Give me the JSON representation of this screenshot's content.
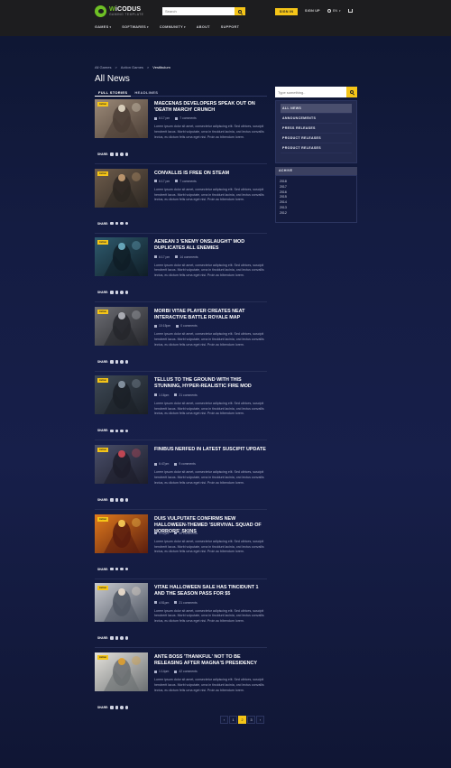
{
  "header": {
    "logo_name_highlight": "W",
    "logo_name_rest": "iCODUS",
    "logo_sub": "GAMING TEMPLATE",
    "search_placeholder": "Search",
    "signin_label": "SIGN IN",
    "signup_label": "SIGN UP",
    "lang": "EN",
    "nav": [
      {
        "label": "GAMES",
        "dropdown": true
      },
      {
        "label": "SOFTWARES",
        "dropdown": true
      },
      {
        "label": "COMMUNITY",
        "dropdown": true
      },
      {
        "label": "ABOUT",
        "dropdown": false
      },
      {
        "label": "SUPPORT",
        "dropdown": false
      }
    ]
  },
  "breadcrumb": [
    "All Games",
    ">",
    "Action Games",
    ">",
    "Vestibulum"
  ],
  "page_title": "All News",
  "tabs": [
    {
      "label": "FULL STORIES",
      "active": true
    },
    {
      "label": "HEADLINES",
      "active": false
    }
  ],
  "share_label": "SHARE:",
  "excerpt": "Lorem ipsum dolor sit amet, consectetur adipiscing elit. Sed ultrices, suscipit hendrerit lacus. Morbi vulputate, urna in tincidunt lacinia, orci lectus convallis lectus, eu dictum felis urna eget nisi. Proin ac bibendum lorem.",
  "posts": [
    {
      "title": "Maecenas developers speak out on 'Death March' crunch",
      "badge": "Action",
      "date": "6:17 pm",
      "comments": "7 comments",
      "img": "warrior"
    },
    {
      "title": "Convallis is free on Steam",
      "badge": "Action",
      "date": "6:17 pm",
      "comments": "7 comments",
      "img": "armor"
    },
    {
      "title": "Aenean 3 'Enemy Onslaught' mod duplicates all enemies",
      "badge": "Action",
      "date": "6:17 pm",
      "comments": "14 comments",
      "img": "city"
    },
    {
      "title": "Morbi vitae player creates neat interactive battle royale map",
      "badge": "Action",
      "date": "10:15pm",
      "comments": "0 comments",
      "img": "mech"
    },
    {
      "title": "Tellus to the ground with this stunning, hyper-realistic fire mod",
      "badge": "Action",
      "date": "1:16pm",
      "comments": "21 comments",
      "img": "ruins"
    },
    {
      "title": "Finibus nerfed in latest suscipit update",
      "badge": "Action",
      "date": "6:47pm",
      "comments": "9 comments",
      "img": "soldier"
    },
    {
      "title": "Duis vulputate confirms new Halloween-themed 'Survival Squad of Horrors' skins",
      "badge": "Action",
      "date": "4:01pm",
      "comments": "40 comments",
      "img": "fire"
    },
    {
      "title": "Vitae Halloween sale has tincidunt 1 and the season pass for $5",
      "badge": "Action",
      "date": "4:51pm",
      "comments": "21 comments",
      "img": "girl"
    },
    {
      "title": "Ante Boss 'Thankful' not to be releasing after Magna's presidency",
      "badge": "Action",
      "date": "1:14pm",
      "comments": "42 comments",
      "img": "backpack"
    }
  ],
  "sidebar": {
    "search_placeholder": "Type something..",
    "categories": [
      {
        "label": "ALL NEWS",
        "active": true
      },
      {
        "label": "ANNOUNCEMENTS",
        "active": false
      },
      {
        "label": "PRESS RELEASES",
        "active": false
      },
      {
        "label": "PRODUCT RELEASES",
        "active": false
      },
      {
        "label": "PRODUCT RELEASES",
        "active": false
      }
    ],
    "archive_title": "ACHIVE",
    "years": [
      "2018",
      "2017",
      "2016",
      "2015",
      "2014",
      "2013",
      "2012"
    ]
  },
  "pagination": {
    "prev": "‹",
    "pages": [
      {
        "label": "1",
        "active": false
      },
      {
        "label": "2",
        "active": true
      },
      {
        "label": "3",
        "active": false
      }
    ],
    "next": "›"
  },
  "colors": {
    "accent": "#f5c518",
    "logo_green": "#6ec025",
    "background": "#141c42"
  }
}
